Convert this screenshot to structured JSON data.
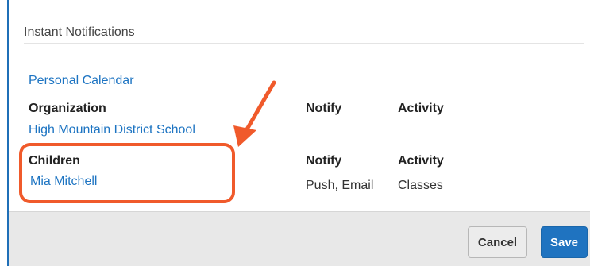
{
  "section": {
    "title": "Instant Notifications"
  },
  "personal_calendar": {
    "label": "Personal Calendar"
  },
  "organization": {
    "heading": "Organization",
    "notify_heading": "Notify",
    "activity_heading": "Activity",
    "item": "High Mountain District School"
  },
  "children": {
    "heading": "Children",
    "notify_heading": "Notify",
    "activity_heading": "Activity",
    "item": "Mia Mitchell",
    "notify_value": "Push, Email",
    "activity_value": "Classes"
  },
  "footer": {
    "cancel_label": "Cancel",
    "save_label": "Save"
  },
  "colors": {
    "link": "#1d74c2",
    "annotation": "#f05a2b",
    "primary_button": "#1f73c0"
  }
}
